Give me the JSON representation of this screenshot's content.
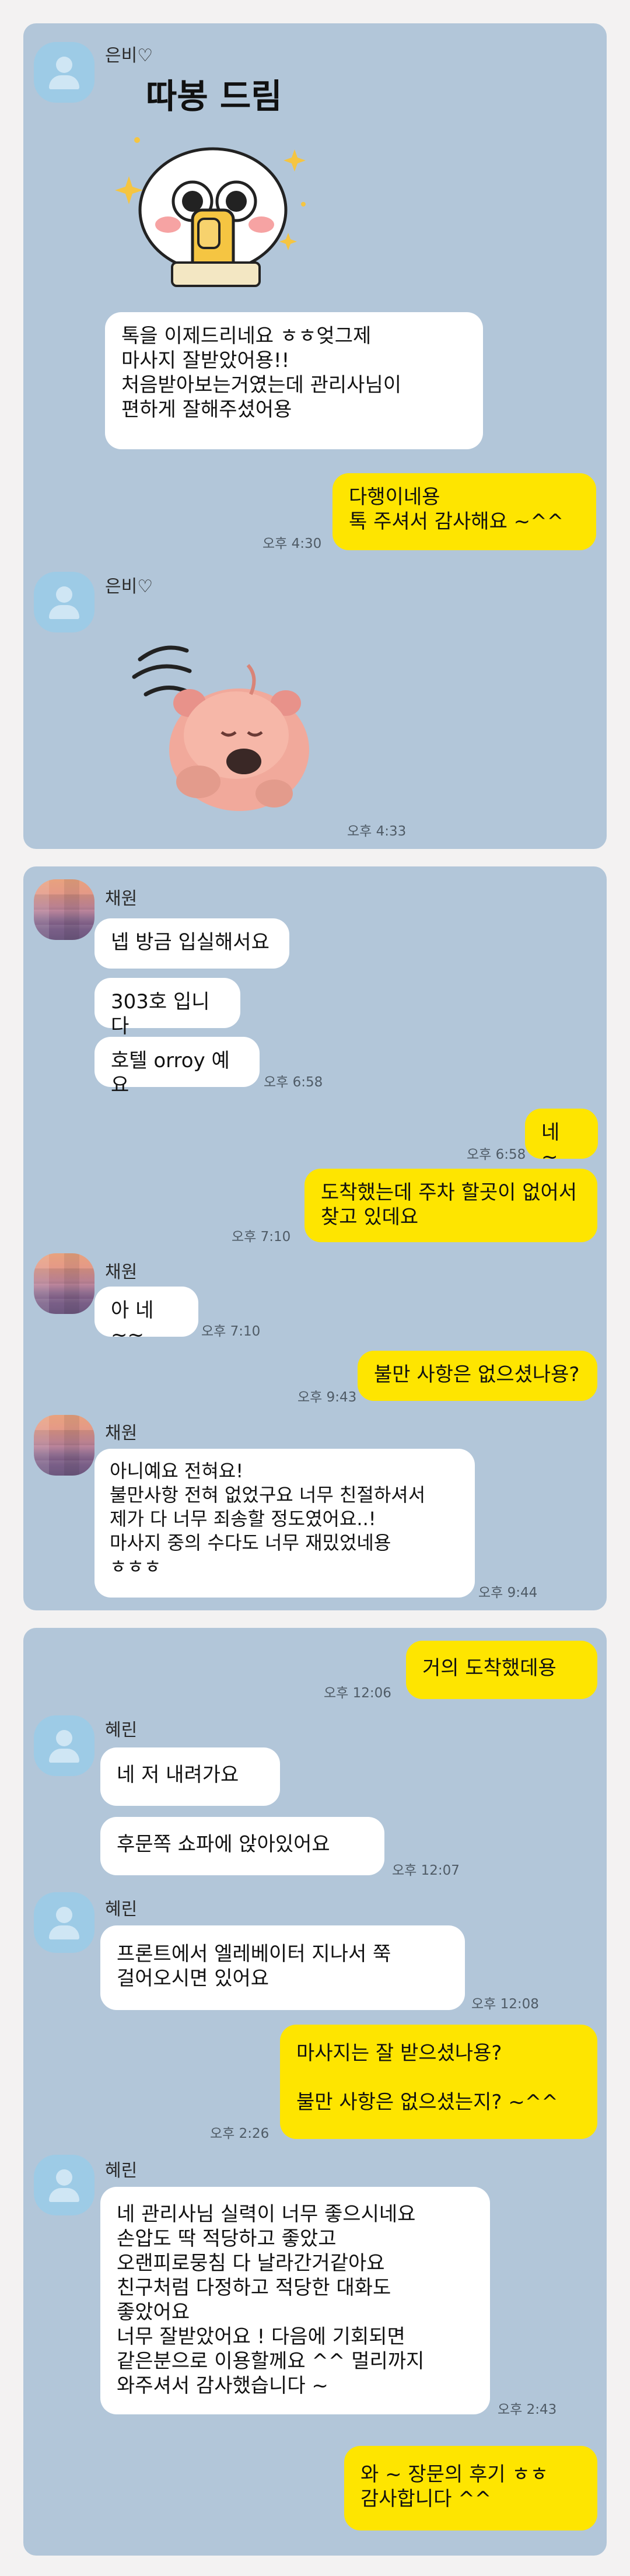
{
  "panel1": {
    "sender": "은비♡",
    "sticker_text": "따봉 드림",
    "msg1": "톡을 이제드리네요 ㅎㅎ엊그제\n마사지 잘받았어용!!\n처음받아보는거였는데 관리사님이\n편하게 잘해주셨어용",
    "reply": "다행이네용\n톡 주셔서 감사해요 ~^^",
    "reply_time": "오후 4:30",
    "sender2": "은비♡",
    "sticker2_time": "오후 4:33"
  },
  "panel2": {
    "sender": "채원",
    "msg1": "넵 방금 입실해서요",
    "msg2": "303호 입니다",
    "msg3": "호텔 orroy 예요",
    "msg3_time": "오후 6:58",
    "me1": "네 ~",
    "me1_time": "오후 6:58",
    "me2": "도착했는데  주차 할곳이 없어서\n찾고 있데요",
    "me2_time": "오후 7:10",
    "sender2": "채원",
    "msg4": "아 네~~",
    "msg4_time": "오후 7:10",
    "me3": "불만 사항은 없으셨나용?",
    "me3_time": "오후 9:43",
    "sender3": "채원",
    "msg5": "아니예요 전혀요!\n불만사항 전혀 없었구요 너무 친절하셔서\n제가 다 너무 죄송할 정도였어요..!\n마사지 중의 수다도 너무 재밌었네용\nㅎㅎㅎ",
    "msg5_time": "오후 9:44"
  },
  "panel3": {
    "me1": "거의 도착했데용",
    "me1_time": "오후 12:06",
    "sender": "혜린",
    "msg1": "네 저 내려가요",
    "msg2": "후문쪽 쇼파에 앉아있어요",
    "msg2_time": "오후 12:07",
    "sender2": "혜린",
    "msg3": "프론트에서 엘레베이터 지나서 쭉\n걸어오시면 있어요",
    "msg3_time": "오후 12:08",
    "me2": "마사지는 잘 받으셨나용?\n\n불만 사항은 없으셨는지? ~^^",
    "me2_time": "오후 2:26",
    "sender3": "혜린",
    "msg4": "네 관리사님 실력이 너무 좋으시네요\n손압도 딱 적당하고 좋았고\n오랜피로뭉침 다 날라간거같아요\n친구처럼 다정하고 적당한 대화도\n좋았어요\n너무 잘받았어요 ! 다음에 기회되면\n같은분으로 이용할께요 ^^ 멀리까지\n와주셔서 감사했습니다 ~",
    "msg4_time": "오후 2:43",
    "me3": "와 ~ 장문의 후기 ㅎㅎ\n감사합니다 ^^"
  }
}
